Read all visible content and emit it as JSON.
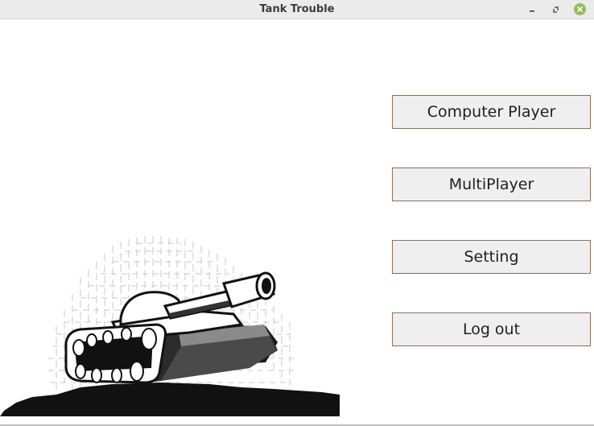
{
  "window": {
    "title": "Tank Trouble",
    "controls": [
      "minimize-icon",
      "restore-icon",
      "close-icon"
    ]
  },
  "menu": {
    "buttons": [
      {
        "label": "Computer Player"
      },
      {
        "label": "MultiPlayer"
      },
      {
        "label": "Setting"
      },
      {
        "label": "Log out"
      }
    ]
  },
  "illustration": {
    "subject": "tank-maze-illustration"
  },
  "colors": {
    "titlebar": "#ebebeb",
    "button_bg": "#efefef",
    "button_border": "#8f6d5b",
    "close_button": "#8fbf55"
  }
}
